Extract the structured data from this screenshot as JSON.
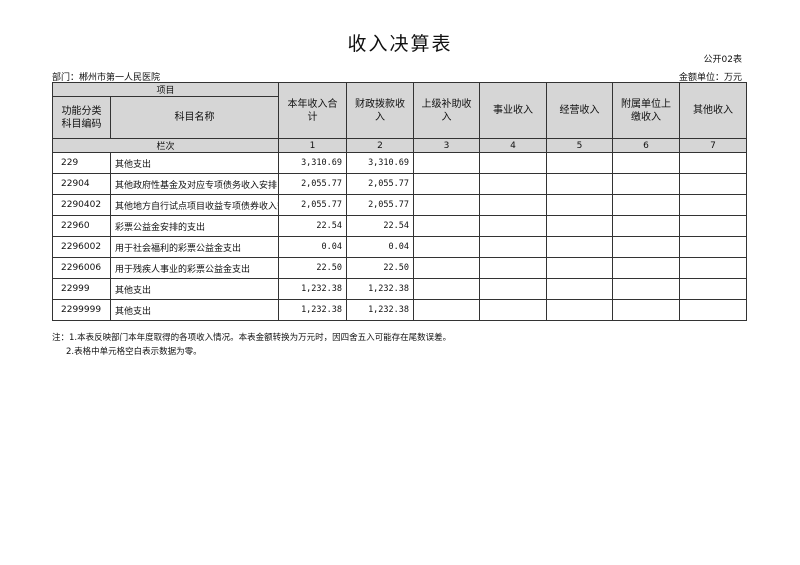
{
  "title": "收入决算表",
  "form_no": "公开02表",
  "department": "部门：郴州市第一人民医院",
  "unit": "金额单位：万元",
  "headers": {
    "item": "项目",
    "func_code": "功能分类科目编码",
    "subject_name": "科目名称",
    "cols": [
      "本年收入合计",
      "财政拨款收入",
      "上级补助收入",
      "事业收入",
      "经营收入",
      "附属单位上缴收入",
      "其他收入"
    ],
    "row_index_label": "栏次",
    "col_numbers": [
      "1",
      "2",
      "3",
      "4",
      "5",
      "6",
      "7"
    ]
  },
  "rows": [
    {
      "code": "229",
      "name": "其他支出",
      "total": "3,310.69",
      "fiscal": "3,310.69"
    },
    {
      "code": "22904",
      "name": "其他政府性基金及对应专项债务收入安排",
      "total": "2,055.77",
      "fiscal": "2,055.77"
    },
    {
      "code": "2290402",
      "name": "其他地方自行试点项目收益专项债券收入安",
      "total": "2,055.77",
      "fiscal": "2,055.77"
    },
    {
      "code": "22960",
      "name": "彩票公益金安排的支出",
      "total": "22.54",
      "fiscal": "22.54"
    },
    {
      "code": "2296002",
      "name": "用于社会福利的彩票公益金支出",
      "total": "0.04",
      "fiscal": "0.04"
    },
    {
      "code": "2296006",
      "name": "用于残疾人事业的彩票公益金支出",
      "total": "22.50",
      "fiscal": "22.50"
    },
    {
      "code": "22999",
      "name": "其他支出",
      "total": "1,232.38",
      "fiscal": "1,232.38"
    },
    {
      "code": "2299999",
      "name": "其他支出",
      "total": "1,232.38",
      "fiscal": "1,232.38"
    }
  ],
  "notes": [
    "注：1.本表反映部门本年度取得的各项收入情况。本表金额转换为万元时，因四舍五入可能存在尾数误差。",
    "2.表格中单元格空白表示数据为零。"
  ]
}
